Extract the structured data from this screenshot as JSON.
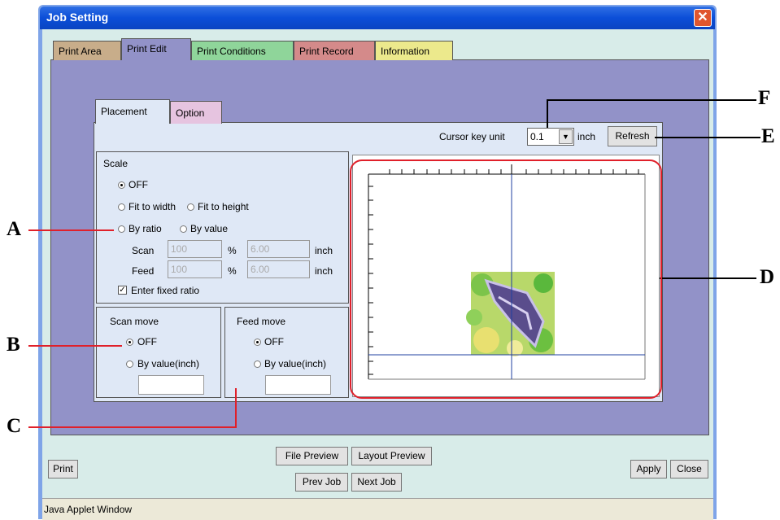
{
  "window": {
    "title": "Job Setting",
    "close_glyph": "✕",
    "status": "Java Applet Window"
  },
  "tabs": [
    "Print Area",
    "Print Edit",
    "Print Conditions",
    "Print Record",
    "Information"
  ],
  "subtabs": [
    "Placement",
    "Option"
  ],
  "cursor": {
    "label": "Cursor key unit",
    "value": "0.1",
    "unit": "inch",
    "refresh_label": "Refresh"
  },
  "scale": {
    "title": "Scale",
    "off": "OFF",
    "fit_width": "Fit to width",
    "fit_height": "Fit to height",
    "by_ratio": "By ratio",
    "by_value": "By value",
    "scan_label": "Scan",
    "scan_percent": "100",
    "scan_inch": "6.00",
    "feed_label": "Feed",
    "feed_percent": "100",
    "feed_inch": "6.00",
    "percent_unit": "%",
    "inch_unit": "inch",
    "fixed_ratio": "Enter fixed ratio"
  },
  "scan_move": {
    "title": "Scan move",
    "off": "OFF",
    "by_value": "By value(inch)"
  },
  "feed_move": {
    "title": "Feed move",
    "off": "OFF",
    "by_value": "By value(inch)"
  },
  "buttons": {
    "print": "Print",
    "file_preview": "File Preview",
    "layout_preview": "Layout Preview",
    "prev_job": "Prev Job",
    "next_job": "Next Job",
    "apply": "Apply",
    "close": "Close"
  },
  "callouts": {
    "a": "A",
    "b": "B",
    "c": "C",
    "d": "D",
    "e": "E",
    "f": "F"
  },
  "colors": {
    "callout_line": "#e0202a",
    "panel": "#9292c8",
    "guide": "#2040a0"
  }
}
